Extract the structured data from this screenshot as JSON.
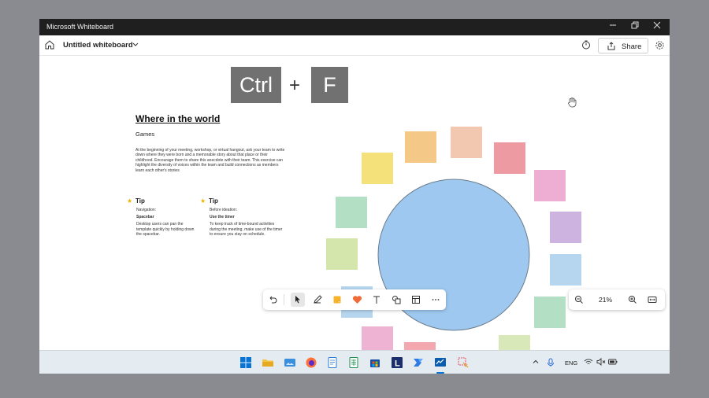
{
  "window": {
    "title": "Microsoft Whiteboard",
    "controls": [
      "minimize",
      "restore",
      "close"
    ]
  },
  "appbar": {
    "doc_title": "Untitled whiteboard",
    "share_label": "Share",
    "icons": [
      "home-icon",
      "chevron-down-icon",
      "timer-icon",
      "share-icon",
      "gear-icon"
    ]
  },
  "canvas": {
    "keys": {
      "ctrl": "Ctrl",
      "plus": "+",
      "f": "F"
    },
    "heading": "Where in the world",
    "subheading": "Games",
    "paragraph": "At the beginning of your meeting, workshop, or virtual hangout, ask your team to write down where they were born and a memorable story about that place or their childhood. Encourage them to share this anecdote with their team. This exercise can highlight the diversity of voices within the team and build connections as members learn each other's stories",
    "tips": [
      {
        "title": "Tip",
        "context": "Navigation:",
        "bold": "Spacebar",
        "body": "Desktop users can pan the template quickly by holding down the spacebar."
      },
      {
        "title": "Tip",
        "context": "Before ideation:",
        "bold": "Use the timer",
        "body": "To keep track of time-bound activities during the meeting, make use of the timer to ensure you stay on schedule."
      }
    ],
    "circle_color": "#9ec8ef",
    "note_colors": [
      "#f5e17a",
      "#f4c987",
      "#f3c8b1",
      "#ee9aa3",
      "#eeaed3",
      "#cdb4e0",
      "#b6d6ef",
      "#b3e0c4",
      "#d5e6ad",
      "#b3e0c4",
      "#d8e8b8",
      "#b6d6ef",
      "#eeb3d2",
      "#f3a8b0",
      "#b9c6f0"
    ]
  },
  "toolbar": {
    "tools": [
      "undo-icon",
      "select-icon",
      "pen-icon",
      "sticky-note-icon",
      "reactions-icon",
      "text-icon",
      "shapes-icon",
      "templates-icon",
      "more-icon"
    ]
  },
  "zoom": {
    "value": "21%"
  },
  "taskbar": {
    "apps": [
      "start-icon",
      "file-explorer-icon",
      "photos-icon",
      "firefox-icon",
      "notepad-icon",
      "spreadsheet-icon",
      "store-icon",
      "l-app-icon",
      "power-automate-icon",
      "whiteboard-icon",
      "snipping-tool-icon"
    ],
    "language": "ENG"
  }
}
